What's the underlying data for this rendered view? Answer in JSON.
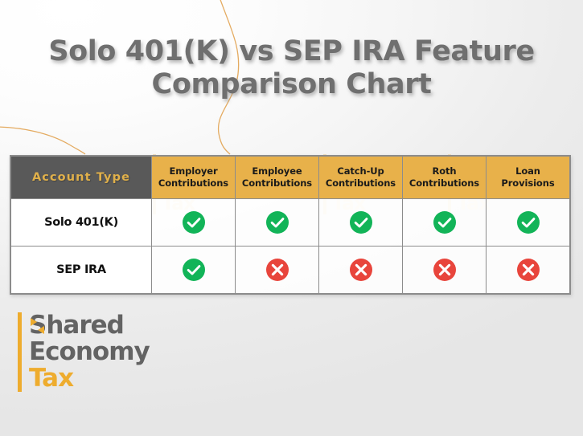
{
  "slide": {
    "title_line1": "Solo 401(K) vs SEP IRA Feature",
    "title_line2": "Comparison Chart",
    "background_color": "#ececec",
    "accent_gold": "#e8b14a",
    "accent_dark": "#595959",
    "check_color": "#12b458",
    "cross_color": "#e8453c"
  },
  "watermark": {
    "line1": "Shared",
    "line2": "Economy",
    "line3": "Tax"
  },
  "logo": {
    "line1": "Shared",
    "line2": "Economy",
    "line3": "Tax"
  },
  "chart_data": {
    "type": "table",
    "title": "Solo 401(K) vs SEP IRA Feature Comparison Chart",
    "columns": [
      {
        "label": "Account Type",
        "line1": "Account Type",
        "line2": ""
      },
      {
        "label": "Employer Contributions",
        "line1": "Employer",
        "line2": "Contributions"
      },
      {
        "label": "Employee Contributions",
        "line1": "Employee",
        "line2": "Contributions"
      },
      {
        "label": "Catch-Up Contributions",
        "line1": "Catch-Up",
        "line2": "Contributions"
      },
      {
        "label": "Roth Contributions",
        "line1": "Roth",
        "line2": "Contributions"
      },
      {
        "label": "Loan Provisions",
        "line1": "Loan",
        "line2": "Provisions"
      }
    ],
    "rows": [
      {
        "account_type": "Solo 401(K)",
        "values": [
          "yes",
          "yes",
          "yes",
          "yes",
          "yes"
        ]
      },
      {
        "account_type": "SEP IRA",
        "values": [
          "yes",
          "no",
          "no",
          "no",
          "no"
        ]
      }
    ],
    "legend": [
      {
        "icon": "check-circle-icon",
        "meaning": "yes",
        "color": "#12b458"
      },
      {
        "icon": "cross-circle-icon",
        "meaning": "no",
        "color": "#e8453c"
      }
    ]
  }
}
